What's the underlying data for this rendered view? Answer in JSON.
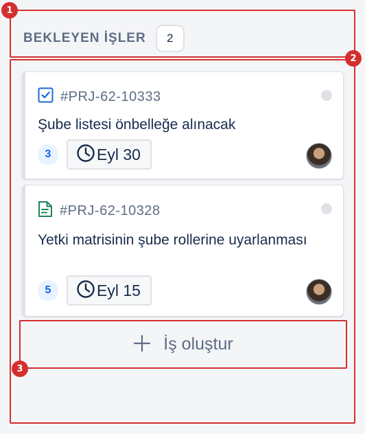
{
  "column": {
    "title": "BEKLEYEN İŞLER",
    "count": "2"
  },
  "annotations": [
    "1",
    "2",
    "3"
  ],
  "cards": [
    {
      "type_icon": "task-checkbox-icon",
      "key": "#PRJ-62-10333",
      "title": "Şube listesi önbelleğe alınacak",
      "points": "3",
      "due": "Eyl 30",
      "avatar": "assignee-avatar"
    },
    {
      "type_icon": "document-icon",
      "key": "#PRJ-62-10328",
      "title": "Yetki matrisinin şube rollerine uyarlanması",
      "points": "5",
      "due": "Eyl 15",
      "avatar": "assignee-avatar"
    }
  ],
  "create_button": {
    "label": "İş oluştur",
    "icon": "plus-icon"
  },
  "colors": {
    "annotation": "#d32f2f",
    "task_icon": "#1868db",
    "document_icon": "#1f845a",
    "points_text": "#0c66e4",
    "points_bg": "#e9f2ff",
    "muted_text": "#5e6c84"
  }
}
